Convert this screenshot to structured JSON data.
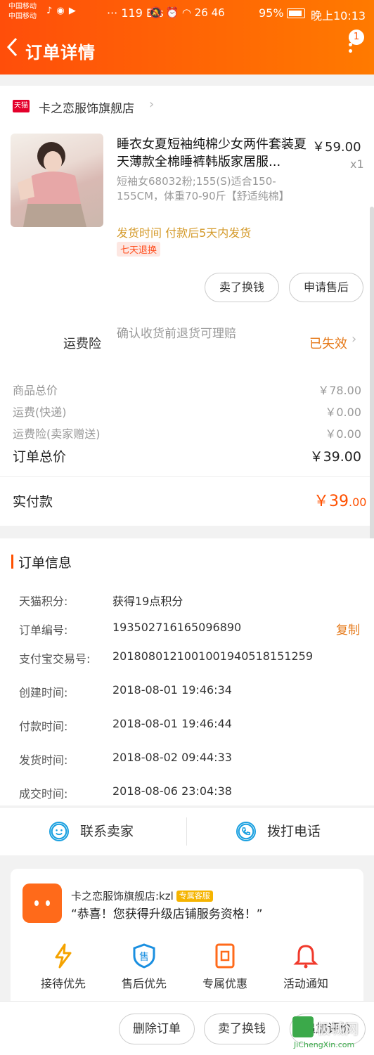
{
  "status_bar": {
    "carrier1": "中国移动",
    "carrier2": "中国移动",
    "speed": "··· 119 B/s",
    "network": "26  46",
    "battery": "95%",
    "time": "晚上10:13"
  },
  "header": {
    "title": "订单详情",
    "badge_count": "1",
    "accent": "#ff5000"
  },
  "store": {
    "platform_badge": "天猫",
    "name": "卡之恋服饰旗舰店"
  },
  "product": {
    "name": "睡衣女夏短袖纯棉少女两件套装夏天薄款全棉睡裤韩版家居服...",
    "price": "￥59.00",
    "qty": "x1",
    "sku": "短袖女68032粉;155(S)适合150-155CM，体重70-90斤【舒适纯棉】",
    "ship_time": "发货时间  付款后5天内发货",
    "return_tag": "七天退换"
  },
  "product_actions": {
    "sell_label": "卖了换钱",
    "after_sale_label": "申请售后"
  },
  "insurance": {
    "label": "运费险",
    "desc": "确认收货前退货可理赔",
    "status": "已失效"
  },
  "costs": [
    {
      "label": "商品总价",
      "value": "￥78.00"
    },
    {
      "label": "运费(快递)",
      "value": "￥0.00"
    },
    {
      "label": "运费险(卖家赠送)",
      "value": "￥0.00"
    }
  ],
  "order_total": {
    "label": "订单总价",
    "value": "￥39.00"
  },
  "paid": {
    "label": "实付款",
    "yuan": "￥39",
    "cents": ".00"
  },
  "order_info": {
    "title": "订单信息",
    "copy_label": "复制",
    "rows": [
      {
        "label": "天猫积分:",
        "value": "获得19点积分"
      },
      {
        "label": "订单编号:",
        "value": "193502716165096890"
      },
      {
        "label": "支付宝交易号:",
        "value": "2018080121001001940518151259"
      },
      {
        "label": "创建时间:",
        "value": "2018-08-01 19:46:34"
      },
      {
        "label": "付款时间:",
        "value": "2018-08-01 19:46:44"
      },
      {
        "label": "发货时间:",
        "value": "2018-08-02 09:44:33"
      },
      {
        "label": "成交时间:",
        "value": "2018-08-06 23:04:38"
      }
    ]
  },
  "contact": {
    "seller_label": "联系卖家",
    "call_label": "拨打电话"
  },
  "promo": {
    "shop": "卡之恋服饰旗舰店:kzl",
    "tag": "专属客服",
    "message": "“恭喜！您获得升级店铺服务资格！”",
    "benefits": [
      {
        "label": "接待优先",
        "icon": "lightning-icon"
      },
      {
        "label": "售后优先",
        "icon": "shield-icon",
        "glyph": "售"
      },
      {
        "label": "专属优惠",
        "icon": "coupon-icon"
      },
      {
        "label": "活动通知",
        "icon": "bell-icon"
      }
    ]
  },
  "bottom_bar": {
    "delete_label": "删除订单",
    "sell_label": "卖了换钱",
    "review_label": "追加评价"
  },
  "watermark": {
    "text": "极城网",
    "url": "JiChengXin.com"
  }
}
